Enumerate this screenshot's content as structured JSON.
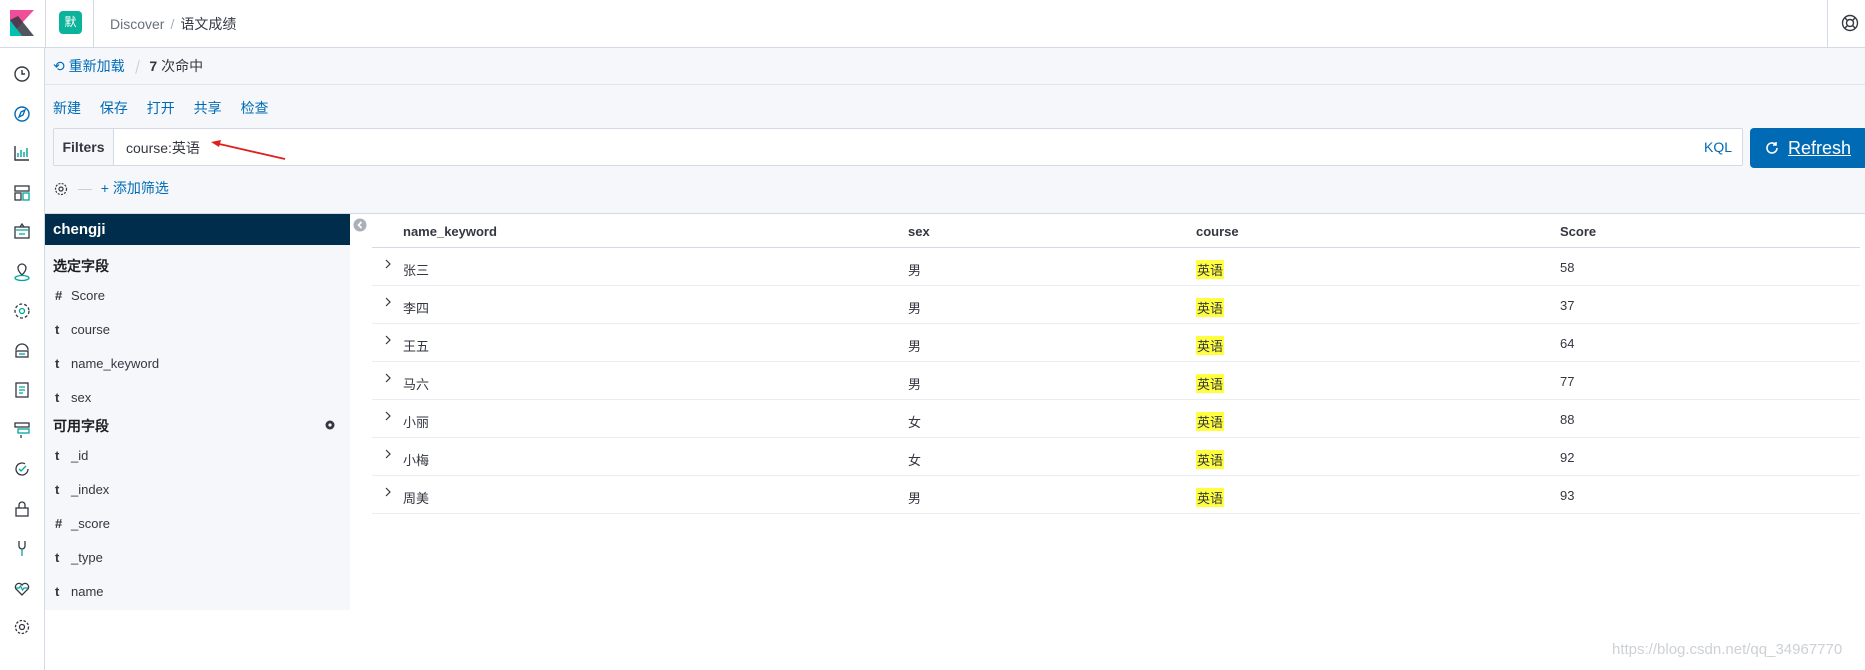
{
  "header": {
    "space_badge": "默",
    "breadcrumbs": [
      "Discover",
      "语文成绩"
    ]
  },
  "querybar": {
    "reload_label": "重新加载",
    "hits_count": "7",
    "hits_label": "次命中",
    "menu": [
      "新建",
      "保存",
      "打开",
      "共享",
      "检查"
    ],
    "filters_label": "Filters",
    "query": "course:英语",
    "kql_label": "KQL",
    "refresh_label": "Refresh",
    "add_filter_label": "+ 添加筛选"
  },
  "sidebar": {
    "index_pattern": "chengji",
    "selected_title": "选定字段",
    "selected_fields": [
      {
        "type": "#",
        "name": "Score"
      },
      {
        "type": "t",
        "name": "course"
      },
      {
        "type": "t",
        "name": "name_keyword"
      },
      {
        "type": "t",
        "name": "sex"
      }
    ],
    "available_title": "可用字段",
    "available_fields": [
      {
        "type": "t",
        "name": "_id"
      },
      {
        "type": "t",
        "name": "_index"
      },
      {
        "type": "#",
        "name": "_score"
      },
      {
        "type": "t",
        "name": "_type"
      },
      {
        "type": "t",
        "name": "name"
      }
    ]
  },
  "table": {
    "columns": [
      "name_keyword",
      "sex",
      "course",
      "Score"
    ],
    "rows": [
      [
        "张三",
        "男",
        "英语",
        "58"
      ],
      [
        "李四",
        "男",
        "英语",
        "37"
      ],
      [
        "王五",
        "男",
        "英语",
        "64"
      ],
      [
        "马六",
        "男",
        "英语",
        "77"
      ],
      [
        "小丽",
        "女",
        "英语",
        "88"
      ],
      [
        "小梅",
        "女",
        "英语",
        "92"
      ],
      [
        "周美",
        "男",
        "英语",
        "93"
      ]
    ]
  },
  "watermark": "https://blog.csdn.net/qq_34967770",
  "colors": {
    "primary": "#006bb4",
    "index_bar": "#002d4b",
    "highlight": "#ffff3f",
    "space_badge": "#0bb39a"
  }
}
